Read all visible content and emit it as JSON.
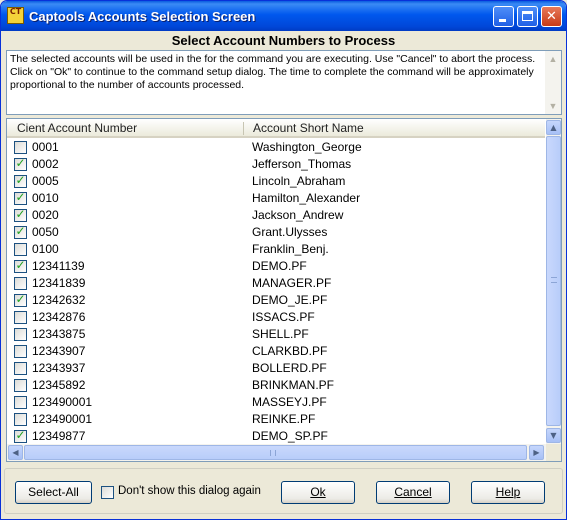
{
  "window": {
    "title": "Captools Accounts Selection Screen",
    "icon_label": "CT",
    "controls": [
      "minimize-icon",
      "maximize-icon",
      "close-icon"
    ],
    "close_glyph": "✕"
  },
  "heading": "Select Account Numbers to Process",
  "description": "The selected accounts will be used in the for the command you are executing.  Use \"Cancel\" to abort the process. Click on \"Ok\" to continue to the command setup dialog.  The time to complete the command will be approximately proportional to the number of accounts processed.",
  "table": {
    "columns": [
      "Cient Account Number",
      "Account Short Name"
    ],
    "rows": [
      {
        "number": "0001",
        "name": "Washington_George",
        "checked": false
      },
      {
        "number": "0002",
        "name": "Jefferson_Thomas",
        "checked": true
      },
      {
        "number": "0005",
        "name": "Lincoln_Abraham",
        "checked": true
      },
      {
        "number": "0010",
        "name": "Hamilton_Alexander",
        "checked": true
      },
      {
        "number": "0020",
        "name": "Jackson_Andrew",
        "checked": true
      },
      {
        "number": "0050",
        "name": "Grant.Ulysses",
        "checked": true
      },
      {
        "number": "0100",
        "name": "Franklin_Benj.",
        "checked": false
      },
      {
        "number": "12341139",
        "name": "DEMO.PF",
        "checked": true
      },
      {
        "number": "12341839",
        "name": "MANAGER.PF",
        "checked": false
      },
      {
        "number": "12342632",
        "name": "DEMO_JE.PF",
        "checked": true
      },
      {
        "number": "12342876",
        "name": "ISSACS.PF",
        "checked": false
      },
      {
        "number": "12343875",
        "name": "SHELL.PF",
        "checked": false
      },
      {
        "number": "12343907",
        "name": "CLARKBD.PF",
        "checked": false
      },
      {
        "number": "12343937",
        "name": "BOLLERD.PF",
        "checked": false
      },
      {
        "number": "12345892",
        "name": "BRINKMAN.PF",
        "checked": false
      },
      {
        "number": "123490001",
        "name": "MASSEYJ.PF",
        "checked": false
      },
      {
        "number": "123490001",
        "name": "REINKE.PF",
        "checked": false
      },
      {
        "number": "12349877",
        "name": "DEMO_SP.PF",
        "checked": true
      }
    ]
  },
  "footer": {
    "select_all": "Select-All",
    "dont_show": "Don't show this dialog again",
    "dont_show_checked": false,
    "ok": "Ok",
    "cancel": "Cancel",
    "help": "Help"
  },
  "icons": {
    "check": "✓",
    "scroll_up": "▲",
    "scroll_down": "▼",
    "scroll_left": "◀",
    "scroll_right": "▶"
  }
}
